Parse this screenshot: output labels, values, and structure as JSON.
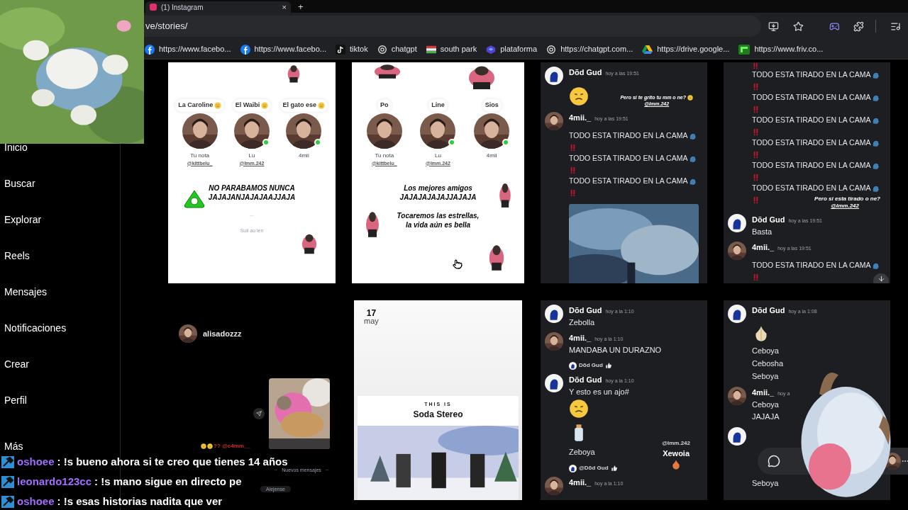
{
  "browser": {
    "tab_title": "(1) Instagram",
    "tab_close": "×",
    "new_tab": "+",
    "address": "ve/stories/",
    "bookmarks": [
      {
        "kind": "facebook",
        "label": "https://www.facebo..."
      },
      {
        "kind": "facebook",
        "label": "https://www.facebo..."
      },
      {
        "kind": "tiktok",
        "label": "tiktok"
      },
      {
        "kind": "chatgpt",
        "label": "chatgpt"
      },
      {
        "kind": "flag",
        "label": "south park"
      },
      {
        "kind": "cube",
        "label": "plataforma"
      },
      {
        "kind": "chatgpt",
        "label": "https://chatgpt.com..."
      },
      {
        "kind": "drive",
        "label": "https://drive.google..."
      },
      {
        "kind": "friv",
        "label": "https://www.friv.co..."
      }
    ]
  },
  "sidebar": [
    {
      "label": "Inicio"
    },
    {
      "label": "Buscar"
    },
    {
      "label": "Explorar"
    },
    {
      "label": "Reels"
    },
    {
      "label": "Mensajes"
    },
    {
      "label": "Notificaciones"
    },
    {
      "label": "Crear"
    },
    {
      "label": "Perfil"
    },
    {
      "label": "Más"
    }
  ],
  "stories": [
    {
      "kind": "notes",
      "logo": true,
      "notes": [
        {
          "bubble": "La Caroline",
          "name": "Tu nota",
          "handle": "@kittbelu_",
          "online": false
        },
        {
          "bubble": "El Waibi",
          "name": "Lu",
          "handle": "@lmm.242",
          "online": true
        },
        {
          "bubble": "El gato ese",
          "name": "4mii",
          "online": true
        }
      ],
      "texts": [
        {
          "kind": "heavy",
          "text": "NO PARABAMOS NUNCA\nJAJAJANJAJAJAAJJAJA"
        },
        {
          "kind": "small",
          "text": "..."
        },
        {
          "kind": "small",
          "text": "Suli au len"
        }
      ]
    },
    {
      "kind": "notes",
      "logo": false,
      "notes": [
        {
          "bubble": "Po",
          "name": "Tu nota",
          "handle": "@kittbelu_",
          "online": false
        },
        {
          "bubble": "Line",
          "name": "Lu",
          "handle": "@lmm.242",
          "online": true
        },
        {
          "bubble": "Sios",
          "name": "4mii",
          "online": true
        }
      ],
      "texts": [
        {
          "kind": "heavy",
          "text": "Los mejores amigos\nJAJAJAJAJAJJAJAJA"
        },
        {
          "kind": "italic",
          "text": "Tocaremos las estrellas,\nla vida aún es bella"
        }
      ]
    },
    {
      "kind": "chat",
      "overlay": {
        "at_top": true,
        "kind": "caption",
        "text": "Pero si te grito tu mm o ne?",
        "mention": "@lmm.242"
      },
      "items": [
        {
          "kind": "message",
          "photo_avatar": false,
          "author": "Dõd Gud",
          "time": "hoy a las 19:51"
        },
        {
          "kind": "face_emoji"
        },
        {
          "kind": "message",
          "photo_avatar": true,
          "author": "4mii._",
          "time": "hoy a las 19:51"
        },
        {
          "kind": "shout",
          "text": "TODO ESTA TIRADO EN LA CAMA"
        },
        {
          "kind": "shout",
          "text": "TODO ESTA TIRADO EN LA CAMA"
        },
        {
          "kind": "shout",
          "text": "TODO ESTA TIRADO EN LA CAMA"
        },
        {
          "kind": "picture"
        }
      ]
    },
    {
      "kind": "chat",
      "scroll_button": true,
      "items": [
        {
          "kind": "bang"
        },
        {
          "kind": "shout",
          "text": "TODO ESTA TIRADO EN LA CAMA"
        },
        {
          "kind": "shout",
          "text": "TODO ESTA TIRADO EN LA CAMA"
        },
        {
          "kind": "shout",
          "text": "TODO ESTA TIRADO EN LA CAMA"
        },
        {
          "kind": "shout",
          "text": "TODO ESTA TIRADO EN LA CAMA"
        },
        {
          "kind": "shout",
          "text": "TODO ESTA TIRADO EN LA CAMA"
        },
        {
          "kind": "shout",
          "text": "TODO ESTA TIRADO EN LA CAMA"
        },
        {
          "kind": "caption",
          "text": "Pero si esta tirado o ne?",
          "mention": "@lmm.242"
        },
        {
          "kind": "message",
          "photo_avatar": false,
          "author": "Dõd Gud",
          "time": "hoy a las 19:51",
          "text": "Basta"
        },
        {
          "kind": "message",
          "photo_avatar": true,
          "author": "4mii._",
          "time": "hoy a las 19:51"
        },
        {
          "kind": "shout",
          "text": "TODO ESTA TIRADO EN LA CAMA"
        }
      ]
    },
    {
      "kind": "dm",
      "user": "alisadozzz",
      "caption": "?? @c4mm__",
      "divider": "Nuevos mensajes",
      "reply": "Alejense"
    },
    {
      "kind": "playlist",
      "day": "17",
      "month": "may",
      "eyebrow": "THIS IS",
      "title": "Soda Stereo"
    },
    {
      "kind": "chat",
      "overlay": {
        "at_top": false,
        "kind": "sticker",
        "text": "Xewoia",
        "mention": "@lmm.242"
      },
      "items": [
        {
          "kind": "message",
          "photo_avatar": false,
          "author": "Dõd Gud",
          "time": "hoy a la 1:10",
          "text": "Zebolla"
        },
        {
          "kind": "message",
          "photo_avatar": true,
          "author": "4mii._",
          "time": "hoy a la 1:10",
          "text": "MANDABA UN DURAZNO"
        },
        {
          "kind": "reply",
          "text": "Dõd Gud"
        },
        {
          "kind": "message",
          "photo_avatar": false,
          "author": "Dõd Gud",
          "time": "hoy a la 1:10",
          "text": "Y esto es un ajo#"
        },
        {
          "kind": "face_emoji"
        },
        {
          "kind": "bottle_emoji"
        },
        {
          "kind": "text",
          "text": "Zeboya"
        },
        {
          "kind": "reply",
          "text": "@Dõd Gud"
        },
        {
          "kind": "message",
          "photo_avatar": true,
          "author": "4mii._",
          "time": "hoy a la 1:10"
        }
      ]
    },
    {
      "kind": "chat",
      "call_bar": true,
      "items": [
        {
          "kind": "message",
          "photo_avatar": false,
          "author": "Dõd Gud",
          "time": "hoy a la 1:08"
        },
        {
          "kind": "garlic_emoji"
        },
        {
          "kind": "text",
          "text": "Ceboya"
        },
        {
          "kind": "text",
          "text": "Cebosha"
        },
        {
          "kind": "text",
          "text": "Seboya"
        },
        {
          "kind": "message",
          "photo_avatar": true,
          "author": "4mii._",
          "time": "hoy a",
          "text": "Ceboya"
        },
        {
          "kind": "text",
          "text": "JAJAJA"
        },
        {
          "kind": "message",
          "photo_avatar": false
        },
        {
          "kind": "gap"
        },
        {
          "kind": "text",
          "text": "Seboya"
        }
      ]
    }
  ],
  "stream_chat": [
    {
      "user": "oshoee",
      "message": ": !s bueno ahora si te creo que tienes 14 años"
    },
    {
      "user": "leonardo123cc",
      "message": ": !s mano sigue en directo pe"
    },
    {
      "user": "oshoee",
      "message": ": !s esas historias nadita que ver"
    }
  ]
}
